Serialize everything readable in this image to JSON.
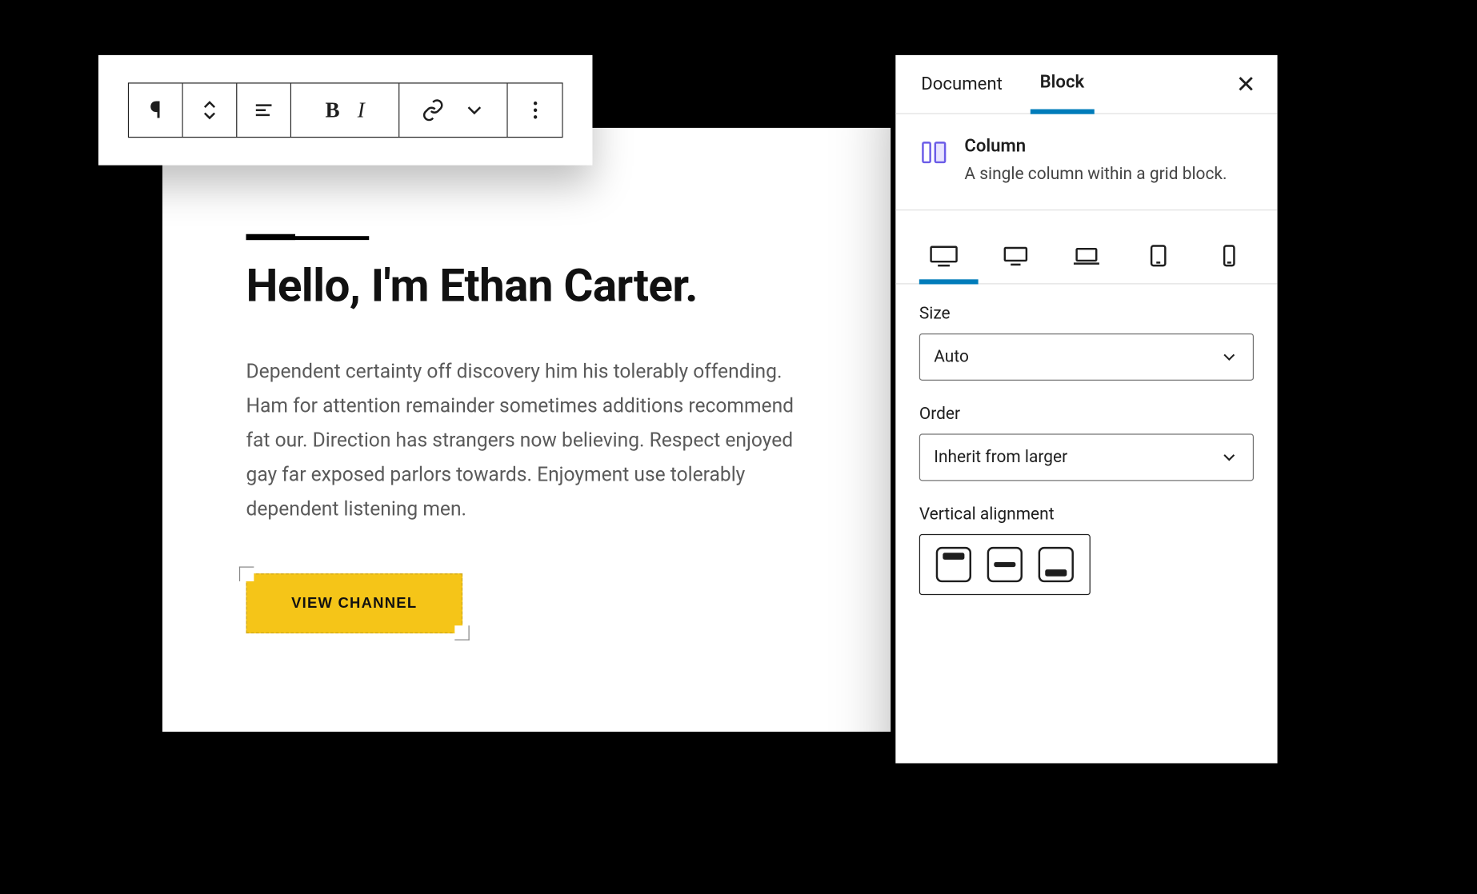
{
  "toolbar": {
    "icons": [
      "paragraph",
      "drag",
      "align-left",
      "bold",
      "italic",
      "link",
      "chevron-down",
      "more"
    ]
  },
  "content": {
    "headline": "Hello, I'm Ethan Carter.",
    "body": "Dependent certainty off discovery him his tolerably offending. Ham for attention remainder sometimes additions recommend fat our. Direction has strangers now believing. Respect enjoyed gay far exposed parlors towards. Enjoyment use tolerably dependent listening men.",
    "cta_label": "VIEW CHANNEL"
  },
  "inspector": {
    "tabs": {
      "document": "Document",
      "block": "Block"
    },
    "active_tab": "block",
    "block": {
      "title": "Column",
      "description": "A single column within a grid block."
    },
    "devices": [
      "desktop-xl",
      "desktop",
      "laptop",
      "tablet",
      "mobile"
    ],
    "size": {
      "label": "Size",
      "value": "Auto"
    },
    "order": {
      "label": "Order",
      "value": "Inherit from larger"
    },
    "valign": {
      "label": "Vertical alignment",
      "options": [
        "top",
        "middle",
        "bottom"
      ]
    }
  }
}
